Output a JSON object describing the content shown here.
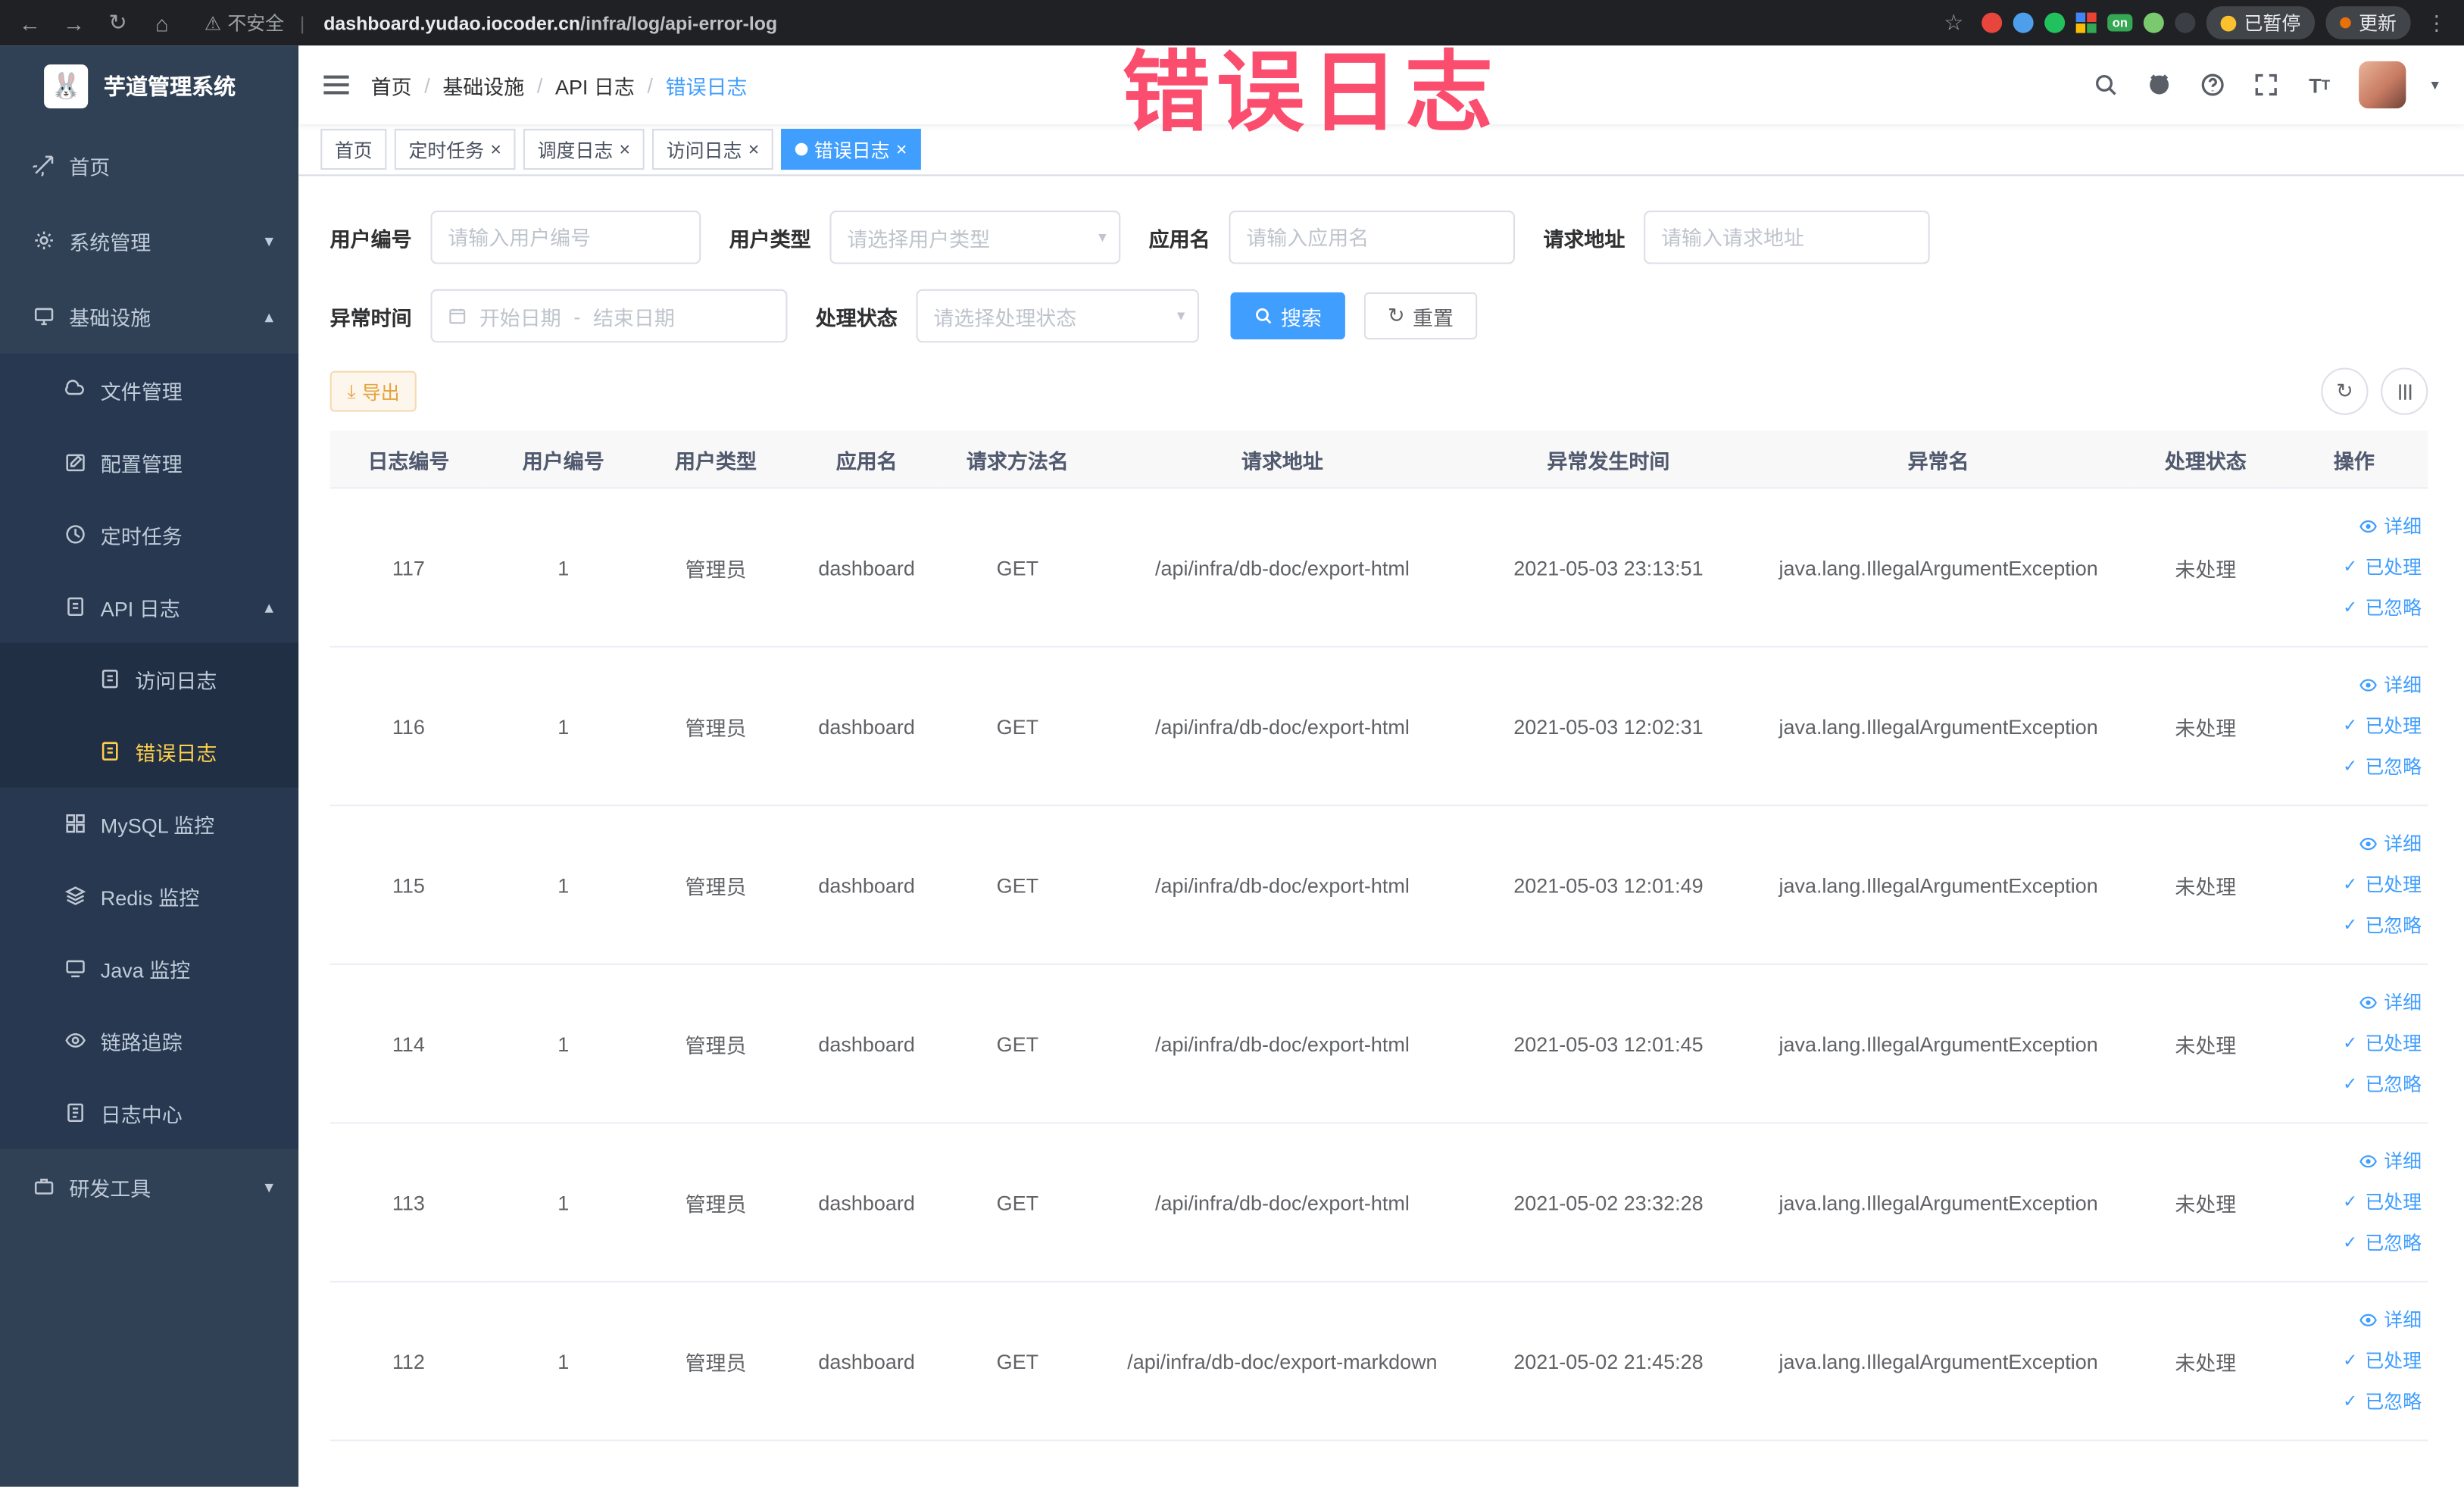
{
  "colors": {
    "accent": "#409eff",
    "warning": "#e6a23c",
    "warning-bg": "#fdf6ec",
    "warning-border": "#f5dab1",
    "sidebar-bg": "#304156",
    "sidebar-sub-bg": "#273850",
    "sidebar-deep-bg": "#212f45",
    "menu-active": "#ffd04b",
    "annotation": "#fb4d6e",
    "chrome-bg": "#202124"
  },
  "browser": {
    "warning_label": "不安全",
    "url_host": "dashboard.yudao.iocoder.cn",
    "url_path": "/infra/log/api-error-log",
    "on_badge": "on",
    "paused_label": "已暂停",
    "update_label": "更新"
  },
  "annotation": {
    "text": "错误日志"
  },
  "sidebar": {
    "title": "芋道管理系统",
    "items": [
      {
        "label": "首页"
      },
      {
        "label": "系统管理"
      },
      {
        "label": "基础设施"
      },
      {
        "label": "文件管理"
      },
      {
        "label": "配置管理"
      },
      {
        "label": "定时任务"
      },
      {
        "label": "API 日志"
      },
      {
        "label": "访问日志"
      },
      {
        "label": "错误日志"
      },
      {
        "label": "MySQL 监控"
      },
      {
        "label": "Redis 监控"
      },
      {
        "label": "Java 监控"
      },
      {
        "label": "链路追踪"
      },
      {
        "label": "日志中心"
      },
      {
        "label": "研发工具"
      }
    ]
  },
  "header": {
    "breadcrumb": [
      "首页",
      "基础设施",
      "API 日志",
      "错误日志"
    ]
  },
  "tabs": {
    "items": [
      {
        "label": "首页"
      },
      {
        "label": "定时任务"
      },
      {
        "label": "调度日志"
      },
      {
        "label": "访问日志"
      },
      {
        "label": "错误日志"
      }
    ]
  },
  "filters": {
    "user_id_label": "用户编号",
    "user_id_placeholder": "请输入用户编号",
    "user_type_label": "用户类型",
    "user_type_placeholder": "请选择用户类型",
    "app_label": "应用名",
    "app_placeholder": "请输入应用名",
    "url_label": "请求地址",
    "url_placeholder": "请输入请求地址",
    "time_label": "异常时间",
    "time_start_placeholder": "开始日期",
    "time_separator": "-",
    "time_end_placeholder": "结束日期",
    "status_label": "处理状态",
    "status_placeholder": "请选择处理状态",
    "search_label": "搜索",
    "reset_label": "重置"
  },
  "toolbar": {
    "export_label": "导出"
  },
  "table": {
    "headers": [
      "日志编号",
      "用户编号",
      "用户类型",
      "应用名",
      "请求方法名",
      "请求地址",
      "异常发生时间",
      "异常名",
      "处理状态",
      "操作"
    ],
    "actions": [
      {
        "label": "详细",
        "icon": "eye",
        "name": "detail-link"
      },
      {
        "label": "已处理",
        "icon": "check",
        "name": "processed-link"
      },
      {
        "label": "已忽略",
        "icon": "check",
        "name": "ignored-link"
      }
    ],
    "rows": [
      {
        "cells": [
          "117",
          "1",
          "管理员",
          "dashboard",
          "GET",
          "/api/infra/db-doc/export-html",
          "2021-05-03 23:13:51",
          "java.lang.IllegalArgumentException",
          "未处理"
        ]
      },
      {
        "cells": [
          "116",
          "1",
          "管理员",
          "dashboard",
          "GET",
          "/api/infra/db-doc/export-html",
          "2021-05-03 12:02:31",
          "java.lang.IllegalArgumentException",
          "未处理"
        ]
      },
      {
        "cells": [
          "115",
          "1",
          "管理员",
          "dashboard",
          "GET",
          "/api/infra/db-doc/export-html",
          "2021-05-03 12:01:49",
          "java.lang.IllegalArgumentException",
          "未处理"
        ]
      },
      {
        "cells": [
          "114",
          "1",
          "管理员",
          "dashboard",
          "GET",
          "/api/infra/db-doc/export-html",
          "2021-05-03 12:01:45",
          "java.lang.IllegalArgumentException",
          "未处理"
        ]
      },
      {
        "cells": [
          "113",
          "1",
          "管理员",
          "dashboard",
          "GET",
          "/api/infra/db-doc/export-html",
          "2021-05-02 23:32:28",
          "java.lang.IllegalArgumentException",
          "未处理"
        ]
      },
      {
        "cells": [
          "112",
          "1",
          "管理员",
          "dashboard",
          "GET",
          "/api/infra/db-doc/export-markdown",
          "2021-05-02 21:45:28",
          "java.lang.IllegalArgumentException",
          "未处理"
        ]
      }
    ]
  }
}
